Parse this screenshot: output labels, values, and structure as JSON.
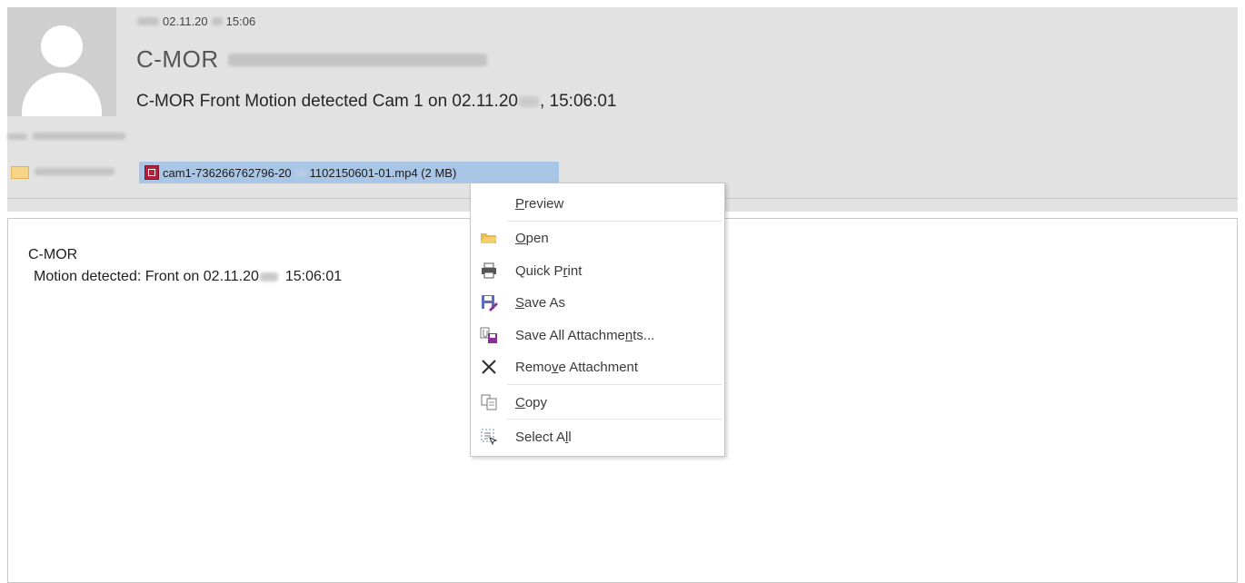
{
  "header": {
    "date": "02.11.20",
    "time": "15:06",
    "sender_name": "C-MOR",
    "subject": {
      "part1": "C-MOR Front Motion detected Cam 1 on 02.11.20",
      "part2": ", 15:06:01"
    }
  },
  "attachment": {
    "part1": "cam1-736266762796-20",
    "part2": "1102150601-01.mp4 (2 MB)"
  },
  "body": {
    "line1": "C-MOR",
    "line2_part1": "Motion detected: Front on 02.11.20",
    "line2_part2": "15:06:01"
  },
  "context_menu": {
    "items": [
      {
        "label": "Preview",
        "icon": "preview-icon"
      },
      {
        "label": "Open",
        "icon": "folder-open-icon"
      },
      {
        "label": "Quick Print",
        "icon": "printer-icon"
      },
      {
        "label": "Save As",
        "icon": "save-as-icon"
      },
      {
        "label": "Save All Attachments...",
        "icon": "save-all-icon"
      },
      {
        "label": "Remove Attachment",
        "icon": "close-x-icon"
      },
      {
        "label": "Copy",
        "icon": "copy-icon"
      },
      {
        "label": "Select All",
        "icon": "select-all-icon"
      }
    ]
  },
  "colors": {
    "header_bg": "#e2e2e2",
    "attachment_highlight": "#a9c6e6",
    "file_icon": "#b5203b"
  }
}
